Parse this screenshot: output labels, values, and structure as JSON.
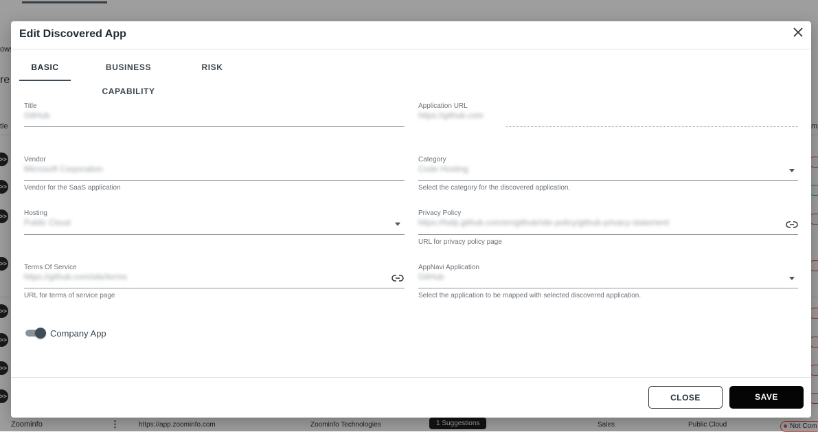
{
  "background": {
    "fragments": [
      "ows",
      "re",
      "tle",
      "mp"
    ],
    "row": {
      "name": "Zoominfo",
      "url": "https://app.zoominfo.com",
      "vendor": "Zoominfo Technologies",
      "suggestions": "1 Suggestions",
      "category": "Sales",
      "hosting": "Public Cloud",
      "status": "Not Com"
    }
  },
  "dialog": {
    "title": "Edit Discovered App",
    "tabs": [
      {
        "label": "BASIC",
        "active": true
      },
      {
        "label": "BUSINESS CAPABILITY",
        "active": false
      },
      {
        "label": "RISK",
        "active": false
      }
    ],
    "fields": {
      "title": {
        "label": "Title",
        "value": "GitHub"
      },
      "app_url": {
        "label": "Application URL",
        "value": "https://github.com"
      },
      "vendor": {
        "label": "Vendor",
        "value": "Microsoft Corporation",
        "help": "Vendor for the SaaS application"
      },
      "category": {
        "label": "Category",
        "value": "Code Hosting",
        "help": "Select the category for the discovered application."
      },
      "hosting": {
        "label": "Hosting",
        "value": "Public Cloud"
      },
      "privacy": {
        "label": "Privacy Policy",
        "value": "https://help.github.com/en/github/site-policy/github-privacy-statement",
        "help": "URL for privacy policy page"
      },
      "terms": {
        "label": "Terms Of Service",
        "value": "https://github.com/site/terms",
        "help": "URL for terms of service page"
      },
      "appnavi": {
        "label": "AppNavi Application",
        "value": "GitHub",
        "help": "Select the application to be mapped with selected discovered application."
      }
    },
    "company_app": {
      "label": "Company App",
      "checked": true
    },
    "buttons": {
      "close": "CLOSE",
      "save": "SAVE"
    }
  },
  "icons": [
    "close-icon",
    "chevron-down-icon",
    "link-icon"
  ]
}
